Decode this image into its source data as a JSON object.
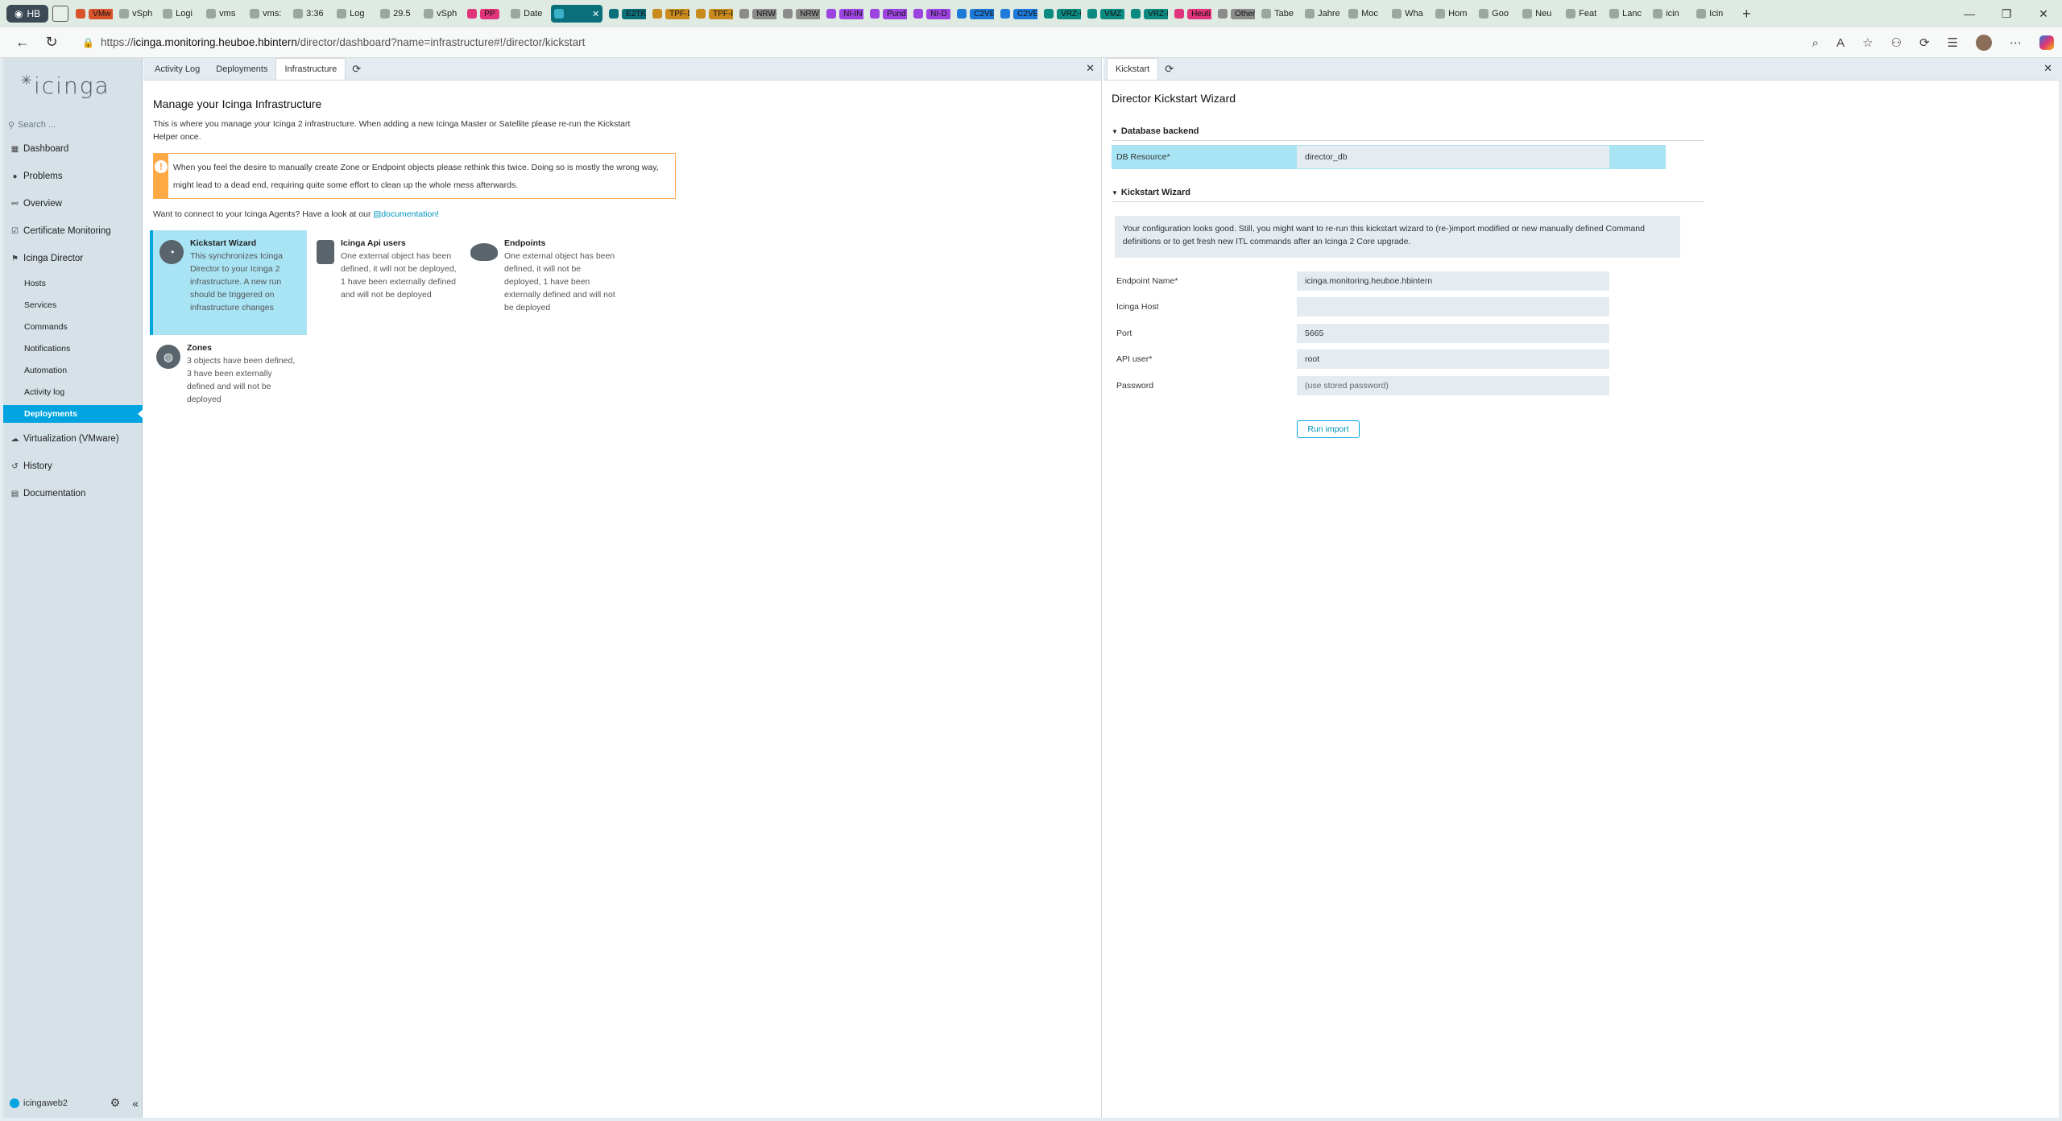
{
  "browser": {
    "profile_label": "HB",
    "tabs": [
      {
        "label": "VMw",
        "color": "#d9532c"
      },
      {
        "label": "vSph",
        "color": ""
      },
      {
        "label": "Logi",
        "color": ""
      },
      {
        "label": "vms",
        "color": ""
      },
      {
        "label": "vms:",
        "color": ""
      },
      {
        "label": "3:36",
        "color": ""
      },
      {
        "label": "Log",
        "color": ""
      },
      {
        "label": "29.5",
        "color": ""
      },
      {
        "label": "vSph",
        "color": ""
      },
      {
        "label": "PP",
        "color": "#e0347b"
      },
      {
        "label": "Date",
        "color": ""
      },
      {
        "label": "E2TK",
        "color": "#0a6f7a"
      },
      {
        "label": "TPF-D",
        "color": "#c98b1d"
      },
      {
        "label": "TPF-I",
        "color": "#c98b1d"
      },
      {
        "label": "NRW-",
        "color": "#8b8b8b"
      },
      {
        "label": "NRW",
        "color": "#8b8b8b"
      },
      {
        "label": "NI-IN",
        "color": "#9d44e0"
      },
      {
        "label": "Pund",
        "color": "#9d44e0"
      },
      {
        "label": "NI-D",
        "color": "#9d44e0"
      },
      {
        "label": "C2VE",
        "color": "#1e7ad9"
      },
      {
        "label": "C2VE",
        "color": "#1e7ad9"
      },
      {
        "label": "VRZ-C",
        "color": "#0a8a80"
      },
      {
        "label": "VMZ",
        "color": "#0a8a80"
      },
      {
        "label": "VRZ-I",
        "color": "#0a8a80"
      },
      {
        "label": "Heuti",
        "color": "#e0347b"
      },
      {
        "label": "Other",
        "color": "#8b8b8b"
      },
      {
        "label": "Tabe",
        "color": ""
      },
      {
        "label": "Jahre",
        "color": ""
      },
      {
        "label": "Moc",
        "color": ""
      },
      {
        "label": "Wha",
        "color": ""
      },
      {
        "label": "Hom",
        "color": ""
      },
      {
        "label": "Goo",
        "color": ""
      },
      {
        "label": "Neu",
        "color": ""
      },
      {
        "label": "Feat",
        "color": ""
      },
      {
        "label": "Lanc",
        "color": ""
      },
      {
        "label": "icin",
        "color": ""
      },
      {
        "label": "Icin",
        "color": ""
      }
    ],
    "url_prefix": "https://",
    "url_host": "icinga.monitoring.heuboe.hbintern",
    "url_path": "/director/dashboard?name=infrastructure#!/director/kickstart"
  },
  "sidebar": {
    "logo": "icinga",
    "search_placeholder": "Search ...",
    "items": [
      {
        "label": "Dashboard",
        "icon": "grid-icon"
      },
      {
        "label": "Problems",
        "icon": "problems-icon"
      },
      {
        "label": "Overview",
        "icon": "binoculars-icon"
      },
      {
        "label": "Certificate Monitoring",
        "icon": "check-icon"
      },
      {
        "label": "Icinga Director",
        "icon": "flag-icon"
      }
    ],
    "sub_items": [
      "Hosts",
      "Services",
      "Commands",
      "Notifications",
      "Automation",
      "Activity log",
      "Deployments"
    ],
    "items_after": [
      {
        "label": "Virtualization (VMware)",
        "icon": "cloud-icon"
      },
      {
        "label": "History",
        "icon": "history-icon"
      },
      {
        "label": "Documentation",
        "icon": "book-icon"
      }
    ],
    "user": "icingaweb2"
  },
  "left_pane": {
    "tabs": [
      "Activity Log",
      "Deployments",
      "Infrastructure"
    ],
    "active_tab": "Infrastructure",
    "title": "Manage your Icinga Infrastructure",
    "intro": "This is where you manage your Icinga 2 infrastructure. When adding a new Icinga Master or Satellite please re-run the Kickstart Helper once.",
    "warning": "When you feel the desire to manually create Zone or Endpoint objects please rethink this twice. Doing so is mostly the wrong way, might lead to a dead end, requiring quite some effort to clean up the whole mess afterwards.",
    "agents_text": "Want to connect to your Icinga Agents? Have a look at our",
    "agents_link": "documentation",
    "agents_suffix": "!",
    "tiles": [
      {
        "title": "Kickstart Wizard",
        "desc": "This synchronizes Icinga Director to your Icinga 2 infrastructure. A new run should be triggered on infrastructure changes"
      },
      {
        "title": "Icinga Api users",
        "desc": "One external object has been defined, it will not be deployed, 1 have been externally defined and will not be deployed"
      },
      {
        "title": "Endpoints",
        "desc": "One external object has been defined, it will not be deployed, 1 have been externally defined and will not be deployed"
      },
      {
        "title": "Zones",
        "desc": "3 objects have been defined, 3 have been externally defined and will not be deployed"
      }
    ]
  },
  "right_pane": {
    "tab": "Kickstart",
    "title": "Director Kickstart Wizard",
    "section_db": "Database backend",
    "db_label": "DB Resource*",
    "db_value": "director_db",
    "section_wizard": "Kickstart Wizard",
    "info": "Your configuration looks good. Still, you might want to re-run this kickstart wizard to (re-)import modified or new manually defined Command definitions or to get fresh new ITL commands after an Icinga 2 Core upgrade.",
    "fields": [
      {
        "label": "Endpoint Name*",
        "value": "icinga.monitoring.heuboe.hbintern",
        "placeholder": ""
      },
      {
        "label": "Icinga Host",
        "value": "",
        "placeholder": ""
      },
      {
        "label": "Port",
        "value": "5665",
        "placeholder": ""
      },
      {
        "label": "API user*",
        "value": "root",
        "placeholder": ""
      },
      {
        "label": "Password",
        "value": "",
        "placeholder": "(use stored password)"
      }
    ],
    "submit": "Run import"
  }
}
